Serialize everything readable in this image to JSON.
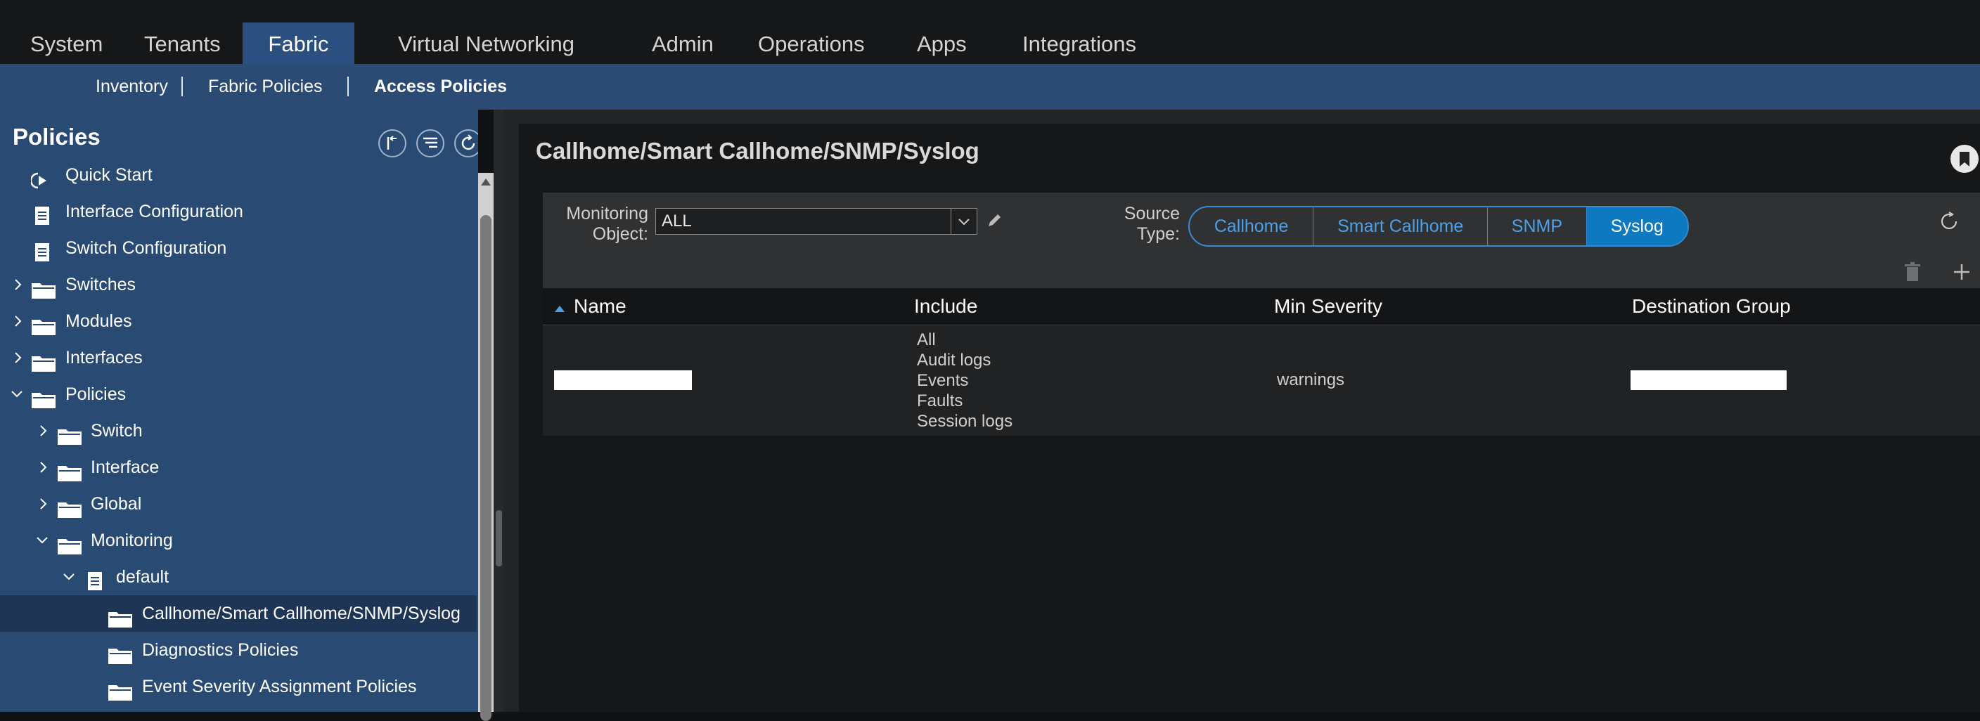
{
  "topnav": {
    "tabs": [
      {
        "label": "System"
      },
      {
        "label": "Tenants"
      },
      {
        "label": "Fabric"
      },
      {
        "label": "Virtual Networking"
      },
      {
        "label": "Admin"
      },
      {
        "label": "Operations"
      },
      {
        "label": "Apps"
      },
      {
        "label": "Integrations"
      }
    ],
    "active_tab": "Fabric"
  },
  "subnav": {
    "items": [
      {
        "label": "Inventory"
      },
      {
        "label": "Fabric Policies"
      },
      {
        "label": "Access Policies"
      }
    ],
    "active_item": "Access Policies"
  },
  "sidebar": {
    "title": "Policies",
    "items": [
      {
        "label": "Quick Start",
        "icon": "quick-start-icon"
      },
      {
        "label": "Interface Configuration",
        "icon": "document-icon"
      },
      {
        "label": "Switch Configuration",
        "icon": "document-icon"
      },
      {
        "label": "Switches",
        "icon": "folder-icon",
        "expanded": false
      },
      {
        "label": "Modules",
        "icon": "folder-icon",
        "expanded": false
      },
      {
        "label": "Interfaces",
        "icon": "folder-icon",
        "expanded": false
      },
      {
        "label": "Policies",
        "icon": "folder-icon",
        "expanded": true
      },
      {
        "label": "Switch",
        "icon": "folder-icon",
        "expanded": false
      },
      {
        "label": "Interface",
        "icon": "folder-icon",
        "expanded": false
      },
      {
        "label": "Global",
        "icon": "folder-icon",
        "expanded": false
      },
      {
        "label": "Monitoring",
        "icon": "folder-icon",
        "expanded": true
      },
      {
        "label": "default",
        "icon": "document-icon",
        "expanded": true
      },
      {
        "label": "Callhome/Smart Callhome/SNMP/Syslog",
        "icon": "folder-icon",
        "selected": true
      },
      {
        "label": "Diagnostics Policies",
        "icon": "folder-icon"
      },
      {
        "label": "Event Severity Assignment Policies",
        "icon": "folder-icon"
      }
    ]
  },
  "main": {
    "title": "Callhome/Smart Callhome/SNMP/Syslog",
    "monitoring_object_label": "Monitoring Object:",
    "monitoring_object_value": "ALL",
    "source_type_label": "Source Type:",
    "source_types": [
      {
        "label": "Callhome"
      },
      {
        "label": "Smart Callhome"
      },
      {
        "label": "SNMP"
      },
      {
        "label": "Syslog"
      }
    ],
    "active_source_type": "Syslog",
    "table": {
      "columns": [
        "Name",
        "Include",
        "Min Severity",
        "Destination Group"
      ],
      "sort_column": "Name",
      "rows": [
        {
          "name": "",
          "include": [
            "All",
            "Audit logs",
            "Events",
            "Faults",
            "Session logs"
          ],
          "min_severity": "warnings",
          "destination_group": ""
        }
      ]
    }
  },
  "colors": {
    "nav_active": "#2b4f7e",
    "subnav_bg": "#2b4b74",
    "sidebar_bg": "#294a73",
    "accent": "#0d79c0",
    "segment_text": "#4ea1e8"
  }
}
